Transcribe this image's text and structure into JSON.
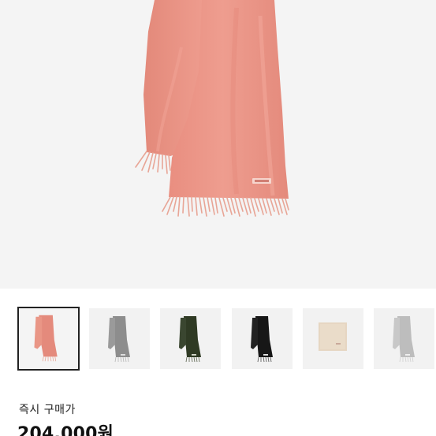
{
  "product": {
    "main_image_icon": "scarf-image",
    "colors": {
      "main_scarf": "#e88f80",
      "fringe": "#e8a596"
    },
    "variants": [
      {
        "icon": "scarf-pink-thumbnail",
        "color": "#e48a7c",
        "selected": true
      },
      {
        "icon": "scarf-grey-thumbnail",
        "color": "#8d8d8d",
        "selected": false
      },
      {
        "icon": "scarf-green-thumbnail",
        "color": "#2f3a24",
        "selected": false
      },
      {
        "icon": "scarf-black-thumbnail",
        "color": "#171717",
        "selected": false
      },
      {
        "icon": "scarf-beige-thumbnail",
        "color": "#e6d6c2",
        "selected": false
      },
      {
        "icon": "scarf-light-grey-thumbnail",
        "color": "#bdbdbd",
        "selected": false
      }
    ]
  },
  "pricing": {
    "label": "즉시 구매가",
    "price": "204,000원"
  }
}
